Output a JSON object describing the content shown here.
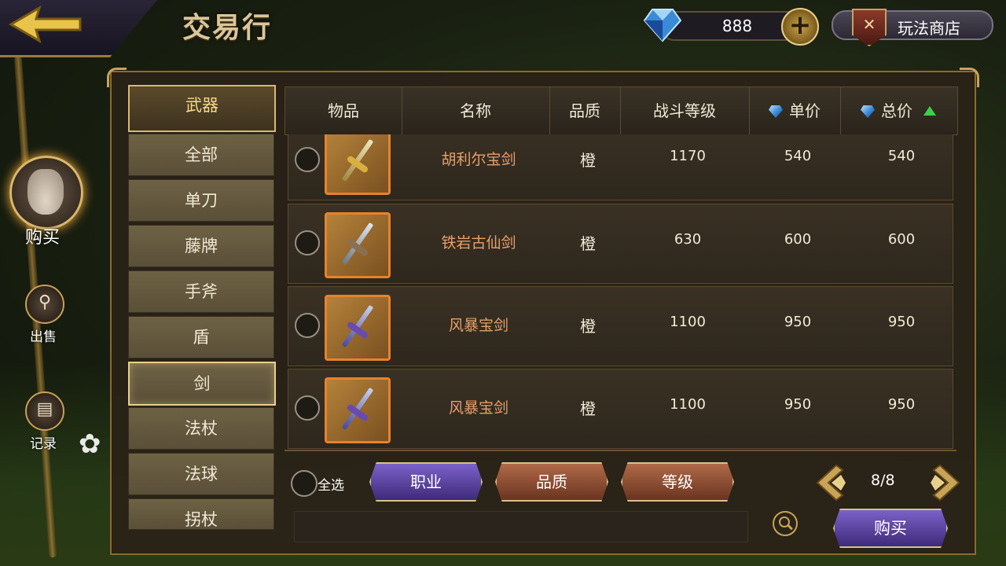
{
  "header": {
    "title": "交易行",
    "currency_value": "888",
    "shop_label": "玩法商店"
  },
  "nav": {
    "buy": "购买",
    "sell": "出售",
    "records": "记录"
  },
  "categories": {
    "header": "武器",
    "items": [
      "全部",
      "单刀",
      "藤牌",
      "手斧",
      "盾",
      "剑",
      "法杖",
      "法球",
      "拐杖"
    ],
    "selected": "剑"
  },
  "table": {
    "columns": [
      "物品",
      "名称",
      "品质",
      "战斗等级",
      "单价",
      "总价"
    ],
    "rows": [
      {
        "name": "胡利尔宝剑",
        "quality": "橙",
        "level": "1170",
        "unit_price": "540",
        "total_price": "540",
        "icon": "golden-sword-icon"
      },
      {
        "name": "铁岩古仙剑",
        "quality": "橙",
        "level": "630",
        "unit_price": "600",
        "total_price": "600",
        "icon": "steel-sword-icon"
      },
      {
        "name": "风暴宝剑",
        "quality": "橙",
        "level": "1100",
        "unit_price": "950",
        "total_price": "950",
        "icon": "storm-sword-icon"
      },
      {
        "name": "风暴宝剑",
        "quality": "橙",
        "level": "1100",
        "unit_price": "950",
        "total_price": "950",
        "icon": "storm-sword-icon"
      }
    ]
  },
  "footer": {
    "select_all": "全选",
    "filter_class": "职业",
    "filter_quality": "品质",
    "filter_level": "等级",
    "page": "8/8",
    "buy_button": "购买"
  },
  "colors": {
    "gold": "#c8a458",
    "quality_orange": "#e8822a",
    "item_name": "#e6a06a",
    "button_purple": "#5a46a8",
    "button_red": "#8a4a30",
    "sort_up_green": "#3ad04a"
  }
}
